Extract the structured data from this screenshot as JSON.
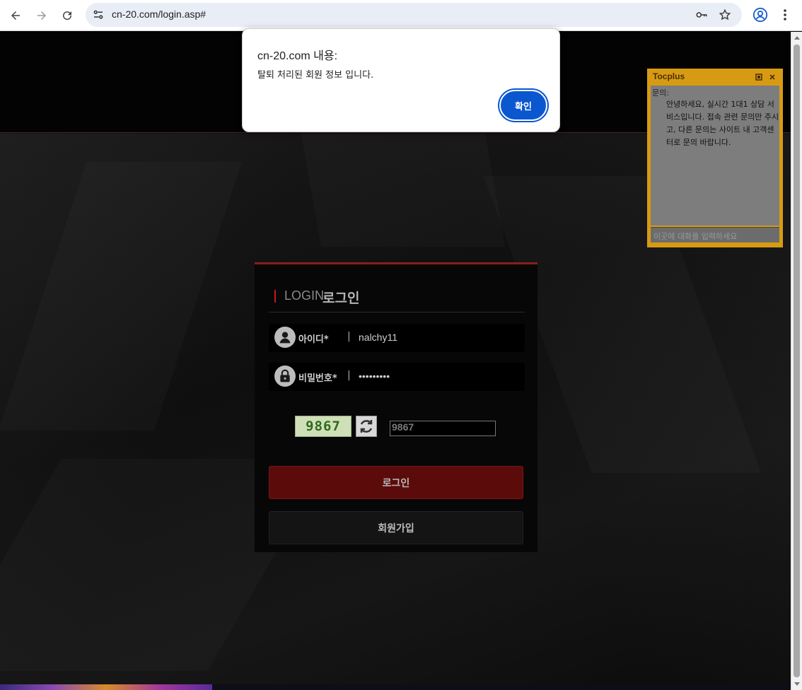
{
  "browser": {
    "url": "cn-20.com/login.asp#",
    "icons": {
      "back": "arrow-left-icon",
      "forward": "arrow-right-icon",
      "reload": "reload-icon",
      "site_info": "tune-icon",
      "password": "key-icon",
      "bookmark": "star-icon",
      "profile": "account-icon",
      "menu": "kebab-menu-icon"
    }
  },
  "dialog": {
    "title": "cn-20.com 내용:",
    "message": "탈퇴 처리된 회원 정보 입니다.",
    "ok_label": "확인",
    "ok_color": "#0b57d0"
  },
  "login": {
    "title_en": "LOGIN",
    "title_ko": "로그인",
    "accent_color": "#c21c1c",
    "id_label": "아이디*",
    "id_value": "nalchy11",
    "pw_label": "비밀번호*",
    "pw_value": "•••••••••",
    "separator": "|",
    "captcha_code": "9867",
    "captcha_input": "9867",
    "login_button": "로그인",
    "join_button": "회원가입"
  },
  "chat": {
    "title": "Tocplus",
    "sender": "문의:",
    "message": "안녕하세요, 실시간 1대1 상담 서비스입니다. 접속 관련 문의만 주시고, 다른 문의는 사이트 내 고객센터로 문의 바랍니다.",
    "input_placeholder": "이곳에 대화를 입력하세요",
    "color": "#d79b13"
  }
}
